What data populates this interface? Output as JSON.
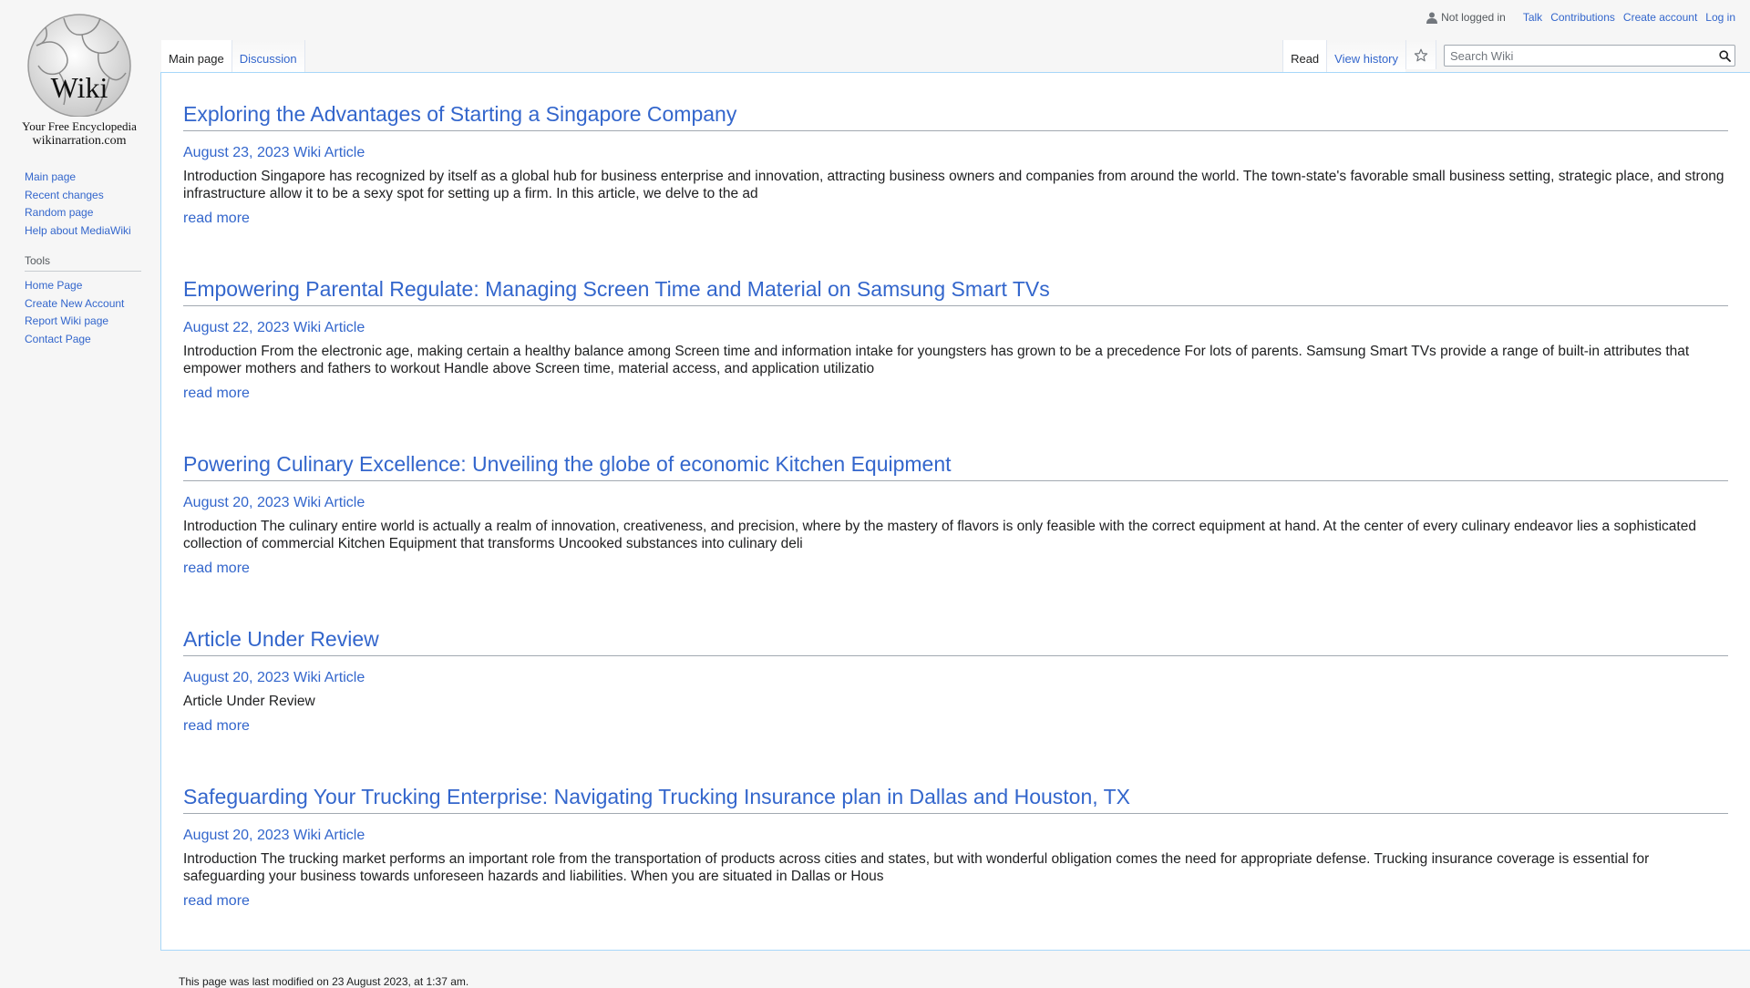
{
  "logo": {
    "title": "Wiki",
    "tagline": "Your Free Encyclopedia",
    "domain": "wikinarration.com"
  },
  "personal": {
    "status": "Not logged in",
    "links": [
      "Talk",
      "Contributions",
      "Create account",
      "Log in"
    ]
  },
  "sidebar": {
    "nav": [
      "Main page",
      "Recent changes",
      "Random page",
      "Help about MediaWiki"
    ],
    "tools_heading": "Tools",
    "tools": [
      "Home Page",
      "Create New Account",
      "Report Wiki page",
      "Contact Page"
    ]
  },
  "tabs": {
    "left": [
      "Main page",
      "Discussion"
    ],
    "right": [
      "Read",
      "View history"
    ]
  },
  "search": {
    "placeholder": "Search Wiki"
  },
  "articles": [
    {
      "title": "Exploring the Advantages of Starting a Singapore Company",
      "meta": "August 23, 2023 Wiki Article",
      "excerpt": "Introduction Singapore has recognized by itself as a global hub for business enterprise and innovation, attracting business owners and companies from around the world. The town-state's favorable small business setting, strategic place, and strong infrastructure allow it to be a sexy spot for setting up a firm. In this article, we delve to the ad",
      "more": "read more"
    },
    {
      "title": "Empowering Parental Regulate: Managing Screen Time and Material on Samsung Smart TVs",
      "meta": "August 22, 2023 Wiki Article",
      "excerpt": "Introduction From the electronic age, making certain a healthy balance among Screen time and information intake for youngsters has grown to be a precedence For lots of parents. Samsung Smart TVs provide a range of built-in attributes that empower mothers and fathers to workout Handle above Screen time, material access, and application utilizatio",
      "more": "read more"
    },
    {
      "title": "Powering Culinary Excellence: Unveiling the globe of economic Kitchen Equipment",
      "meta": "August 20, 2023 Wiki Article",
      "excerpt": "Introduction The culinary entire world is actually a realm of innovation, creativeness, and precision, where by the mastery of flavors is only feasible with the correct equipment at hand. At the center of every culinary endeavor lies a sophisticated collection of commercial Kitchen Equipment that transforms Uncooked substances into culinary deli",
      "more": "read more"
    },
    {
      "title": "Article Under Review",
      "meta": "August 20, 2023 Wiki Article",
      "excerpt": "Article Under Review",
      "more": "read more"
    },
    {
      "title": "Safeguarding Your Trucking Enterprise: Navigating Trucking Insurance plan in Dallas and Houston, TX",
      "meta": "August 20, 2023 Wiki Article",
      "excerpt": "Introduction The trucking market performs an important role from the transportation of products across cities and states, but with wonderful obligation comes the need for appropriate defense. Trucking insurance coverage is essential for safeguarding your business towards unforeseen hazards and liabilities. When you are situated in Dallas or Hous",
      "more": "read more"
    }
  ],
  "footer": {
    "last_modified": "This page was last modified on 23 August 2023, at 1:37 am."
  },
  "icons": {
    "user": "user-icon",
    "star": "star-icon",
    "search": "search-icon",
    "logo": "puzzle-globe-icon"
  },
  "colors": {
    "link": "#3366cc",
    "border_blue": "#a7d7f9",
    "background": "#f6f6f6"
  }
}
